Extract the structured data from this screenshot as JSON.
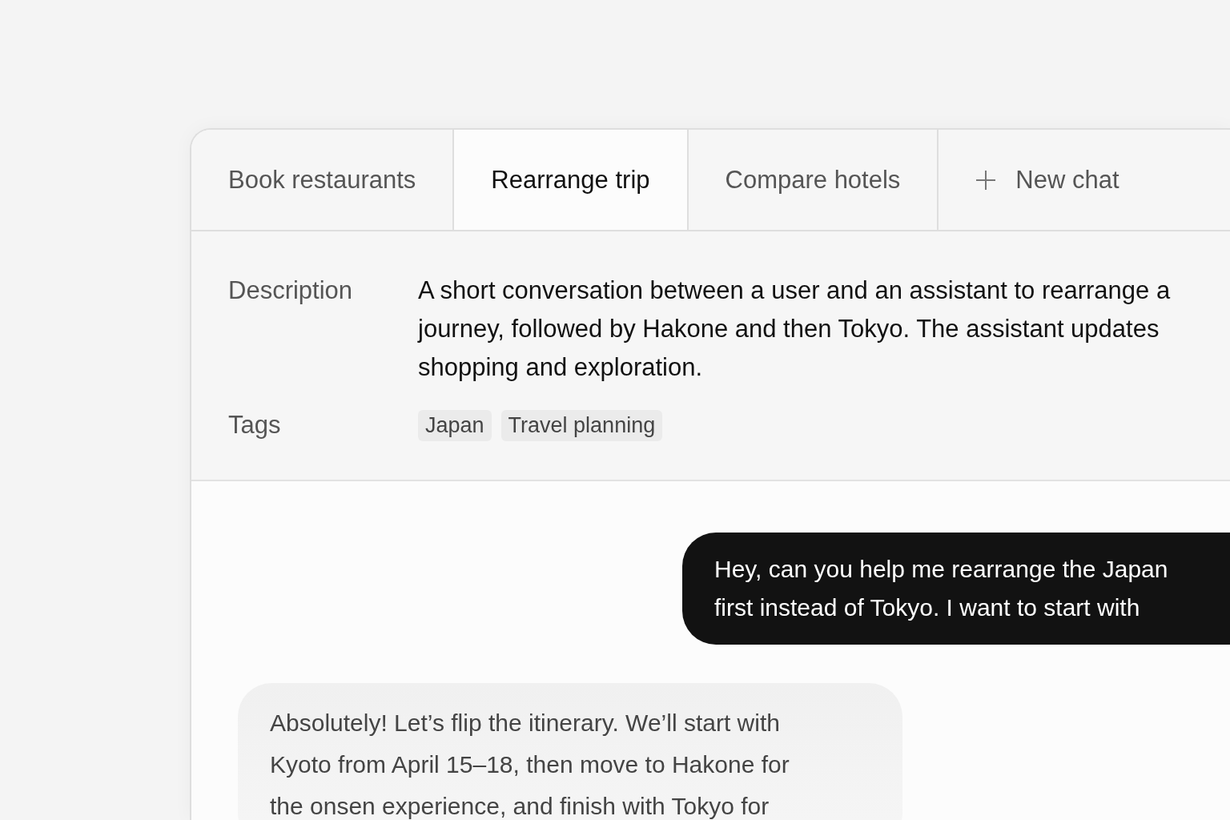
{
  "tabs": [
    {
      "label": "Book restaurants",
      "selected": false,
      "kind": "chat"
    },
    {
      "label": "Rearrange trip",
      "selected": true,
      "kind": "chat"
    },
    {
      "label": "Compare hotels",
      "selected": false,
      "kind": "chat"
    },
    {
      "label": "New chat",
      "selected": false,
      "kind": "new"
    }
  ],
  "details": {
    "description_label": "Description",
    "description_lines": [
      "A short conversation between a user and an assistant to rearrange a",
      "journey, followed by Hakone and then Tokyo. The assistant updates",
      "shopping and exploration."
    ],
    "tags_label": "Tags",
    "tags": [
      "Japan",
      "Travel planning"
    ]
  },
  "messages": [
    {
      "kind": "user",
      "lines": [
        "Hey, can you help me rearrange the Japan",
        "first instead of Tokyo. I want to start with"
      ]
    },
    {
      "kind": "assistant",
      "lines": [
        "Absolutely! Let’s flip the itinerary. We’ll start with",
        "Kyoto from April 15–18, then move to Hakone for",
        "the onsen experience, and finish with Tokyo for"
      ]
    }
  ]
}
